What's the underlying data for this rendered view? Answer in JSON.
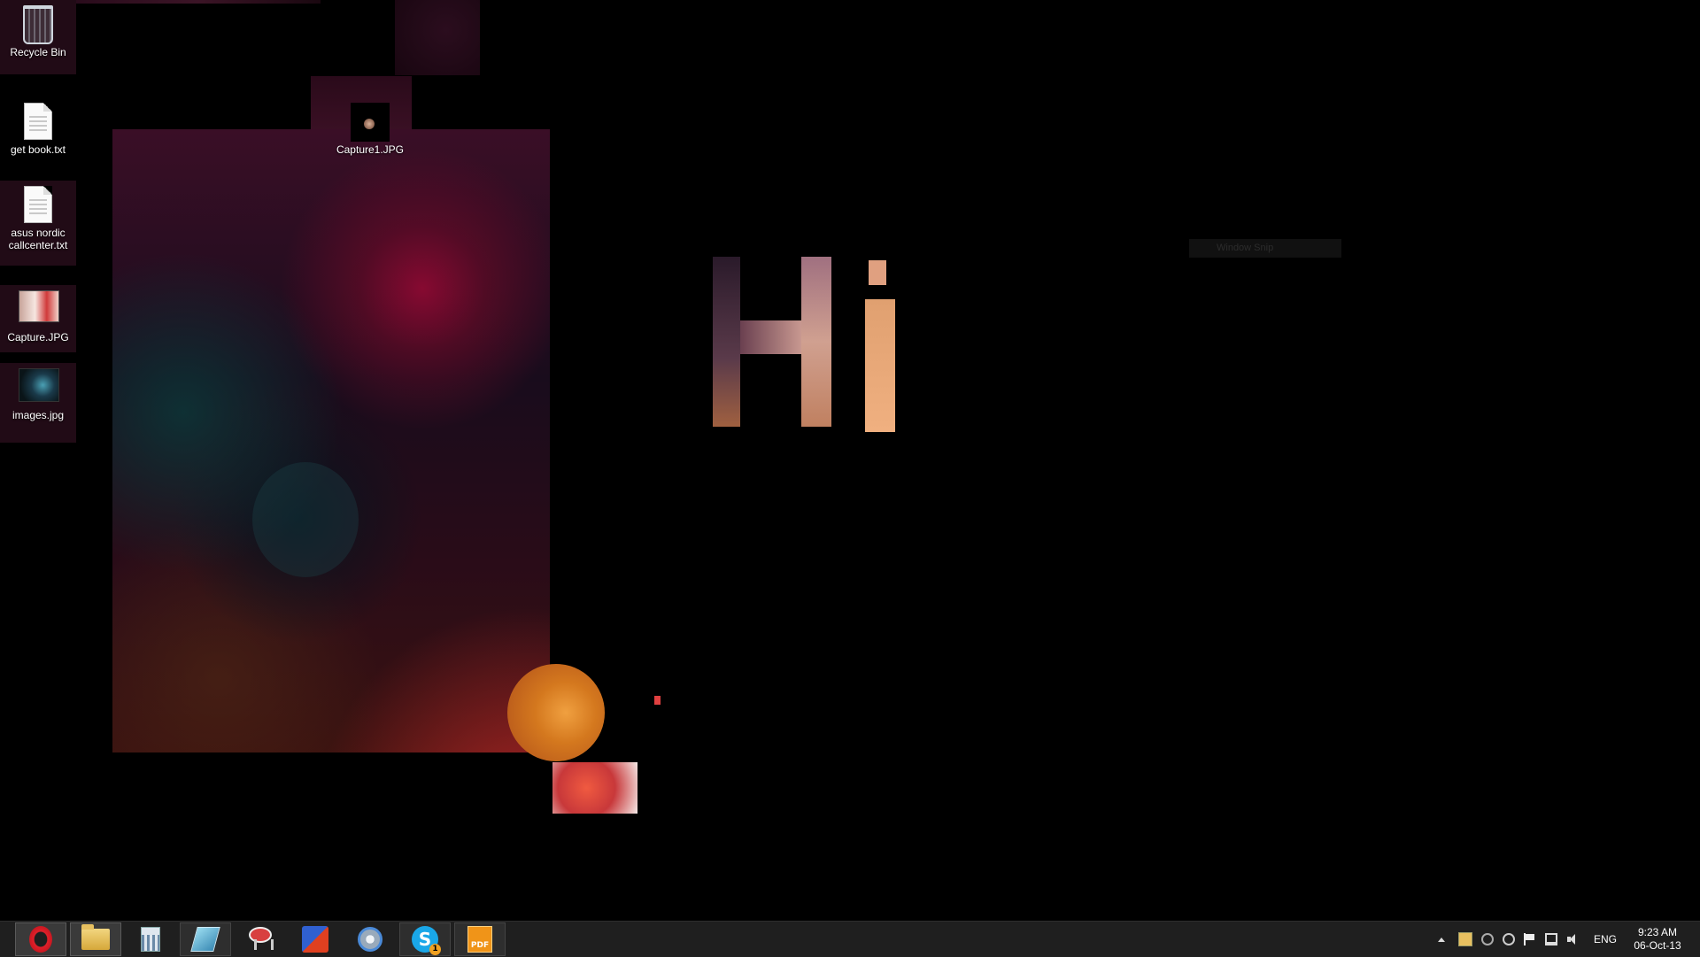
{
  "desktop": {
    "icons": [
      {
        "label": "Recycle Bin",
        "icon": "recycle-bin-icon"
      },
      {
        "label": "get book.txt",
        "icon": "text-file-icon"
      },
      {
        "label": "asus nordic callcenter.txt",
        "icon": "text-file-icon"
      },
      {
        "label": "Capture.JPG",
        "icon": "image-thumbnail-icon"
      },
      {
        "label": "images.jpg",
        "icon": "image-thumbnail-icon"
      },
      {
        "label": "Capture1.JPG",
        "icon": "image-thumbnail-icon"
      }
    ],
    "overlay_text_hi": "Hi",
    "window_snip_label": "Window Snip"
  },
  "taskbar": {
    "pinned": [
      {
        "name": "Opera",
        "icon": "opera-icon"
      },
      {
        "name": "File Explorer",
        "icon": "folder-icon"
      },
      {
        "name": "Calculator",
        "icon": "calculator-icon"
      },
      {
        "name": "Notepad",
        "icon": "notepad-icon"
      },
      {
        "name": "Snipping Tool",
        "icon": "scissors-icon"
      },
      {
        "name": "Movie Maker",
        "icon": "movie-maker-icon"
      },
      {
        "name": "FTP client",
        "icon": "ftp-icon"
      },
      {
        "name": "Skype",
        "icon": "skype-icon",
        "badge": "1",
        "glyph": "S"
      },
      {
        "name": "PDF tool",
        "icon": "pdf-icon",
        "glyph": "PDF"
      }
    ],
    "tray": {
      "language": "ENG",
      "time": "9:23 AM",
      "date": "06-Oct-13"
    }
  }
}
